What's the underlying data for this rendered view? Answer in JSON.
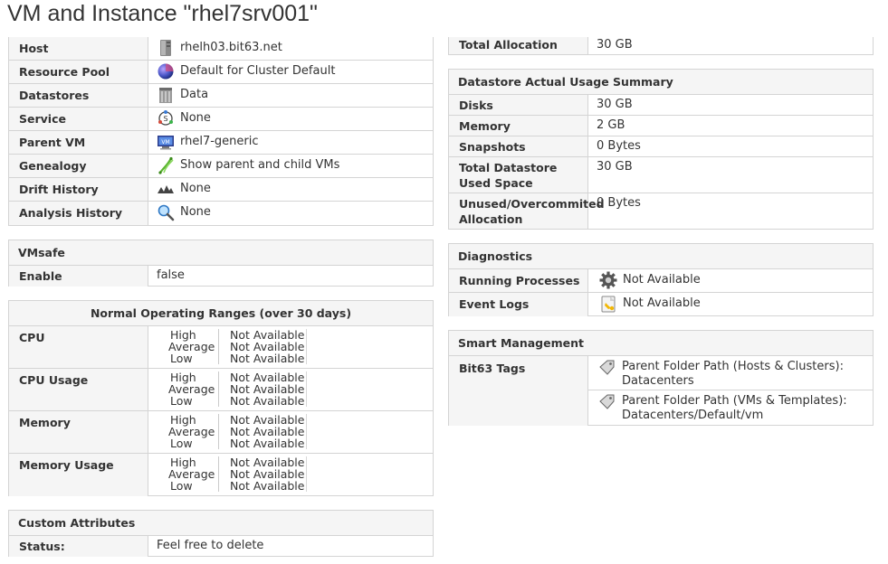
{
  "page": {
    "title": "VM and Instance \"rhel7srv001\""
  },
  "properties": {
    "rows": [
      {
        "label": "Host",
        "value": "rhelh03.bit63.net",
        "icon": "host-icon"
      },
      {
        "label": "Resource Pool",
        "value": "Default for Cluster Default",
        "icon": "resource-pool-icon"
      },
      {
        "label": "Datastores",
        "value": "Data",
        "icon": "datastore-icon"
      },
      {
        "label": "Service",
        "value": "None",
        "icon": "service-icon"
      },
      {
        "label": "Parent VM",
        "value": "rhel7-generic",
        "icon": "vm-icon"
      },
      {
        "label": "Genealogy",
        "value": "Show parent and child VMs",
        "icon": "genealogy-icon"
      },
      {
        "label": "Drift History",
        "value": "None",
        "icon": "drift-icon"
      },
      {
        "label": "Analysis History",
        "value": "None",
        "icon": "magnifier-icon"
      }
    ]
  },
  "vmsafe": {
    "title": "VMsafe",
    "rows": [
      {
        "label": "Enable",
        "value": "false"
      }
    ]
  },
  "ranges": {
    "title": "Normal Operating Ranges (over 30 days)",
    "rows": [
      {
        "label": "CPU",
        "lines": [
          {
            "k": "High",
            "v": "Not Available"
          },
          {
            "k": "Average",
            "v": "Not Available"
          },
          {
            "k": "Low",
            "v": "Not Available"
          }
        ]
      },
      {
        "label": "CPU Usage",
        "lines": [
          {
            "k": "High",
            "v": "Not Available"
          },
          {
            "k": "Average",
            "v": "Not Available"
          },
          {
            "k": "Low",
            "v": "Not Available"
          }
        ]
      },
      {
        "label": "Memory",
        "lines": [
          {
            "k": "High",
            "v": "Not Available"
          },
          {
            "k": "Average",
            "v": "Not Available"
          },
          {
            "k": "Low",
            "v": "Not Available"
          }
        ]
      },
      {
        "label": "Memory Usage",
        "lines": [
          {
            "k": "High",
            "v": "Not Available"
          },
          {
            "k": "Average",
            "v": "Not Available"
          },
          {
            "k": "Low",
            "v": "Not Available"
          }
        ]
      }
    ]
  },
  "custom_attributes": {
    "title": "Custom Attributes",
    "rows": [
      {
        "label": "Status:",
        "value": "Feel free to delete"
      }
    ]
  },
  "allocation": {
    "rows": [
      {
        "label": "Total Allocation",
        "value": "30 GB"
      }
    ]
  },
  "datastore_usage": {
    "title": "Datastore Actual Usage Summary",
    "rows": [
      {
        "label": "Disks",
        "value": "30 GB"
      },
      {
        "label": "Memory",
        "value": "2 GB"
      },
      {
        "label": "Snapshots",
        "value": "0 Bytes"
      },
      {
        "label": "Total Datastore Used Space",
        "value": "30 GB"
      },
      {
        "label": "Unused/Overcommited Allocation",
        "value": "0 Bytes"
      }
    ]
  },
  "diagnostics": {
    "title": "Diagnostics",
    "rows": [
      {
        "label": "Running Processes",
        "value": "Not Available",
        "icon": "gear-icon"
      },
      {
        "label": "Event Logs",
        "value": "Not Available",
        "icon": "event-log-icon"
      }
    ]
  },
  "smart_management": {
    "title": "Smart Management",
    "label": "Bit63 Tags",
    "tags": [
      {
        "line1": "Parent Folder Path (Hosts & Clusters):",
        "line2": "Datacenters",
        "icon": "tag-icon"
      },
      {
        "line1": "Parent Folder Path (VMs & Templates):",
        "line2": "Datacenters/Default/vm",
        "icon": "tag-icon"
      }
    ]
  }
}
